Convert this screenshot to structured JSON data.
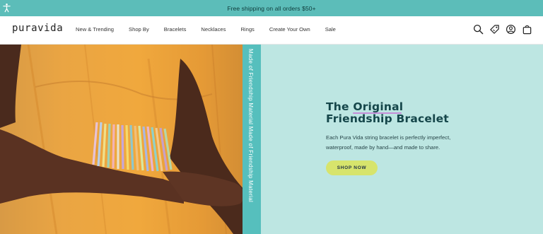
{
  "announcement": {
    "text": "Free shipping on all orders $50+"
  },
  "header": {
    "logo": "puravida",
    "nav_items": [
      "New & Trending",
      "Shop By",
      "Bracelets",
      "Necklaces",
      "Rings",
      "Create Your Own",
      "Sale"
    ],
    "icons": [
      "search-icon",
      "rewards-tag-icon",
      "account-icon",
      "cart-bag-icon"
    ]
  },
  "hero": {
    "side_strip_text": "Made of Friendship Material  Made of Friendship Material",
    "headline_line1_before": "The ",
    "headline_line1_highlight": "Original",
    "headline_line2": "Friendship Bracelet",
    "body": "Each Pura Vida string bracelet is perfectly imperfect, waterproof, made by hand—and made to share.",
    "cta_label": "SHOP NOW"
  },
  "colors": {
    "announcement_bg": "#5cbdb9",
    "hero_panel_bg": "#bde6e2",
    "headline": "#15464a",
    "cta_bg": "#d7e46c",
    "highlight_underline": "#c58ed8"
  }
}
